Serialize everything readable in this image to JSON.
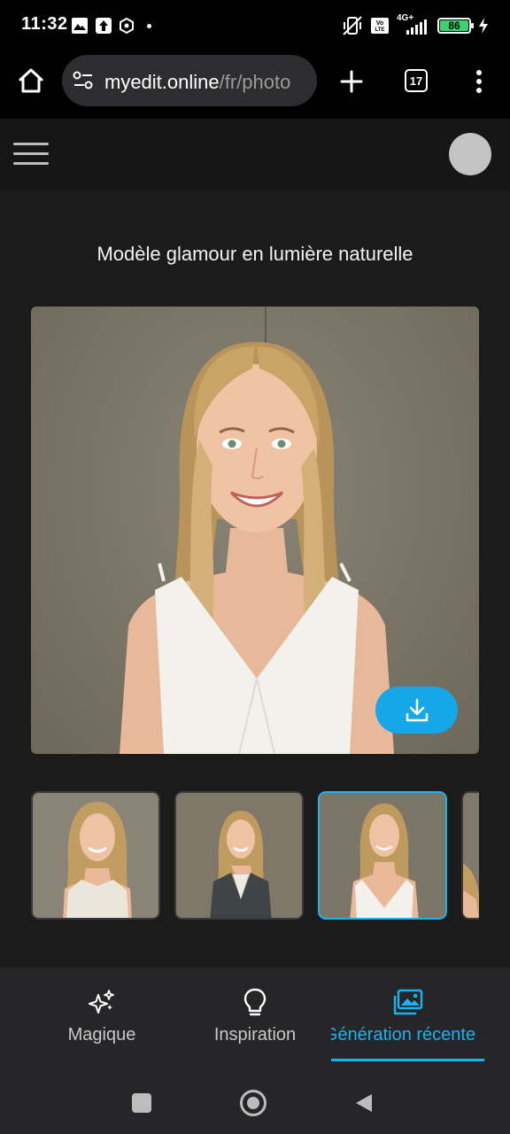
{
  "status_bar": {
    "time": "11:32",
    "network": "4G+",
    "volte": "Vo LTE",
    "battery": "86"
  },
  "browser": {
    "url_host": "myedit.online",
    "url_path": "/fr/photo",
    "tab_count": "17"
  },
  "page": {
    "title": "Modèle glamour en lumière naturelle"
  },
  "thumbnails": [
    {
      "outfit": "white-ruffle-top",
      "selected": false
    },
    {
      "outfit": "grey-cardigan",
      "selected": false
    },
    {
      "outfit": "white-v-neck-dress",
      "selected": true
    },
    {
      "outfit": "partial",
      "selected": false
    }
  ],
  "bottom_nav": {
    "items": [
      {
        "label": "Magique",
        "icon": "sparkles-icon"
      },
      {
        "label": "Inspiration",
        "icon": "lightbulb-icon"
      },
      {
        "label": "Génération récente",
        "icon": "images-icon",
        "active": true
      }
    ]
  },
  "colors": {
    "accent": "#19b3f0",
    "download_button": "#15a7e8"
  }
}
